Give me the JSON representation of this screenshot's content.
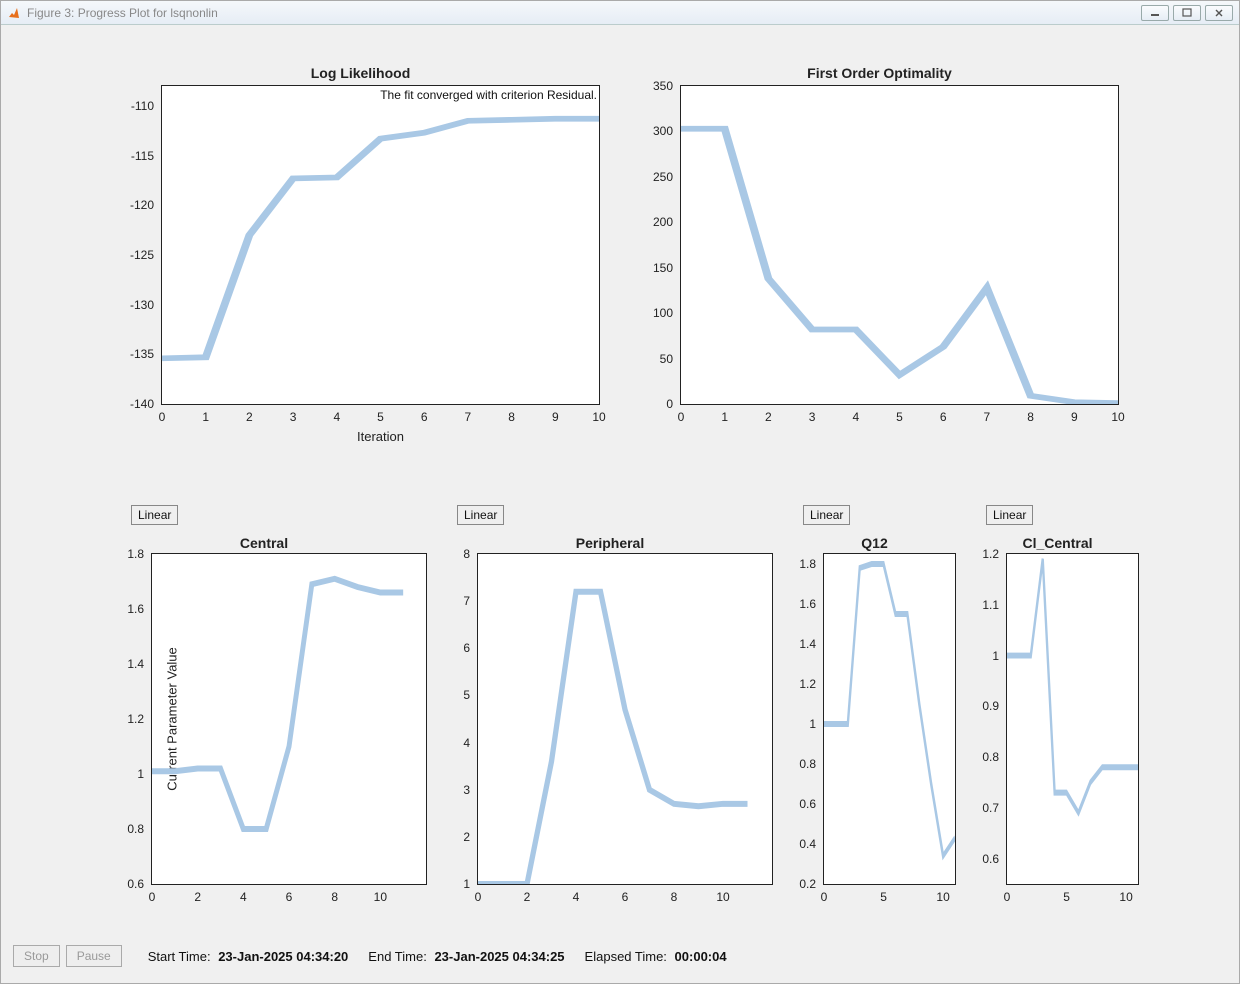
{
  "window": {
    "title": "Figure 3: Progress Plot for lsqnonlin"
  },
  "buttons": {
    "stop": "Stop",
    "pause": "Pause",
    "linear": "Linear"
  },
  "status": {
    "start_label": "Start Time:",
    "start_value": "23-Jan-2025 04:34:20",
    "end_label": "End Time:",
    "end_value": "23-Jan-2025 04:34:25",
    "elapsed_label": "Elapsed Time:",
    "elapsed_value": "00:00:04"
  },
  "chart_data": [
    {
      "type": "line",
      "title": "Log Likelihood",
      "xlabel": "Iteration",
      "ylabel": "",
      "annotation": "The fit converged with criterion Residual.",
      "x_ticks": [
        0,
        1,
        2,
        3,
        4,
        5,
        6,
        7,
        8,
        9,
        10
      ],
      "y_ticks": [
        -140,
        -135,
        -130,
        -125,
        -120,
        -115,
        -110
      ],
      "xlim": [
        0,
        10
      ],
      "ylim": [
        -140,
        -108
      ],
      "x": [
        0,
        1,
        2,
        3,
        4,
        5,
        6,
        7,
        8,
        9,
        10
      ],
      "values": [
        -135.4,
        -135.3,
        -123.0,
        -117.3,
        -117.2,
        -113.3,
        -112.7,
        -111.5,
        -111.4,
        -111.3,
        -111.3
      ]
    },
    {
      "type": "line",
      "title": "First Order Optimality",
      "xlabel": "",
      "ylabel": "",
      "x_ticks": [
        0,
        1,
        2,
        3,
        4,
        5,
        6,
        7,
        8,
        9,
        10
      ],
      "y_ticks": [
        0,
        50,
        100,
        150,
        200,
        250,
        300,
        350
      ],
      "xlim": [
        0,
        10
      ],
      "ylim": [
        0,
        350
      ],
      "x": [
        0,
        1,
        2,
        3,
        4,
        5,
        6,
        7,
        8,
        9,
        10
      ],
      "values": [
        303,
        303,
        138,
        82,
        82,
        32,
        63,
        128,
        9,
        2,
        1
      ]
    },
    {
      "type": "line",
      "title": "Central",
      "xlabel": "",
      "ylabel": "Current Parameter Value",
      "x_ticks": [
        0,
        2,
        4,
        6,
        8,
        10
      ],
      "y_ticks": [
        0.6,
        0.8,
        1.0,
        1.2,
        1.4,
        1.6,
        1.8
      ],
      "xlim": [
        0,
        12
      ],
      "ylim": [
        0.6,
        1.8
      ],
      "x": [
        0,
        1,
        2,
        3,
        4,
        5,
        6,
        7,
        8,
        9,
        10,
        11
      ],
      "values": [
        1.01,
        1.01,
        1.02,
        1.02,
        0.8,
        0.8,
        1.1,
        1.69,
        1.71,
        1.68,
        1.66,
        1.66
      ]
    },
    {
      "type": "line",
      "title": "Peripheral",
      "xlabel": "",
      "ylabel": "",
      "x_ticks": [
        0,
        2,
        4,
        6,
        8,
        10
      ],
      "y_ticks": [
        1,
        2,
        3,
        4,
        5,
        6,
        7,
        8
      ],
      "xlim": [
        0,
        12
      ],
      "ylim": [
        1,
        8
      ],
      "x": [
        0,
        1,
        2,
        3,
        4,
        5,
        6,
        7,
        8,
        9,
        10,
        11
      ],
      "values": [
        1.0,
        1.0,
        1.0,
        3.6,
        7.2,
        7.2,
        4.7,
        3.0,
        2.7,
        2.65,
        2.7,
        2.7
      ]
    },
    {
      "type": "line",
      "title": "Q12",
      "xlabel": "",
      "ylabel": "",
      "x_ticks": [
        0,
        5,
        10
      ],
      "y_ticks": [
        0.2,
        0.4,
        0.6,
        0.8,
        1.0,
        1.2,
        1.4,
        1.6,
        1.8
      ],
      "xlim": [
        0,
        11
      ],
      "ylim": [
        0.2,
        1.85
      ],
      "x": [
        0,
        1,
        2,
        3,
        4,
        5,
        6,
        7,
        8,
        9,
        10,
        11
      ],
      "values": [
        1.0,
        1.0,
        1.0,
        1.78,
        1.8,
        1.8,
        1.55,
        1.55,
        1.1,
        0.7,
        0.34,
        0.43
      ]
    },
    {
      "type": "line",
      "title": "Cl_Central",
      "xlabel": "",
      "ylabel": "",
      "x_ticks": [
        0,
        5,
        10
      ],
      "y_ticks": [
        0.6,
        0.7,
        0.8,
        0.9,
        1.0,
        1.1,
        1.2
      ],
      "xlim": [
        0,
        11
      ],
      "ylim": [
        0.55,
        1.2
      ],
      "x": [
        0,
        1,
        2,
        3,
        4,
        5,
        6,
        7,
        8,
        9,
        10,
        11
      ],
      "values": [
        1.0,
        1.0,
        1.0,
        1.19,
        0.73,
        0.73,
        0.69,
        0.75,
        0.78,
        0.78,
        0.78,
        0.78
      ]
    }
  ]
}
